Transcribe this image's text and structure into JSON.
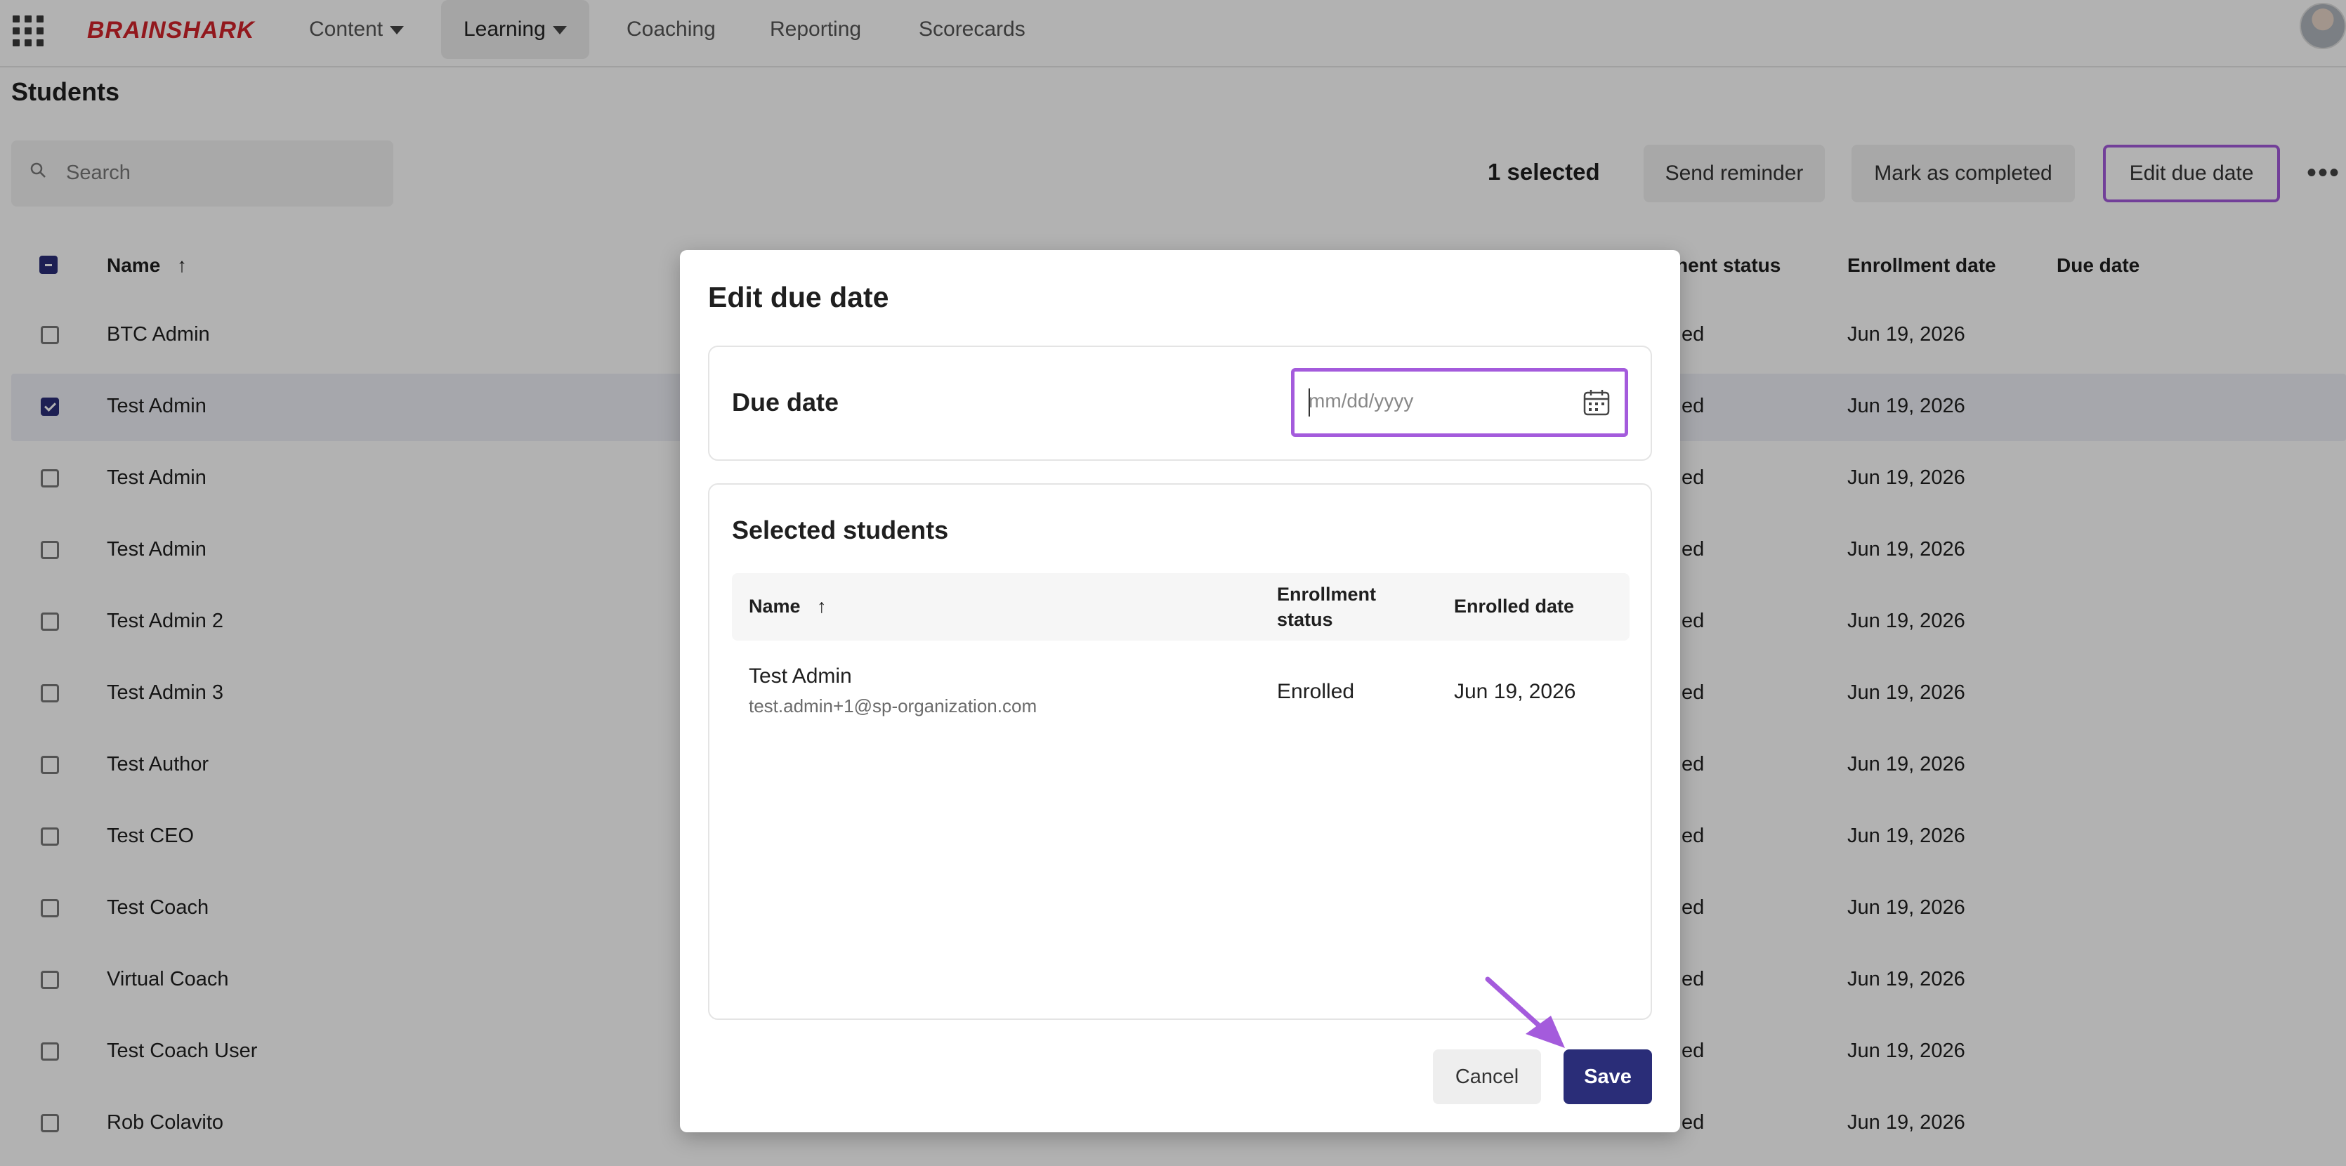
{
  "nav": {
    "logo": "BRAINSHARK",
    "items": [
      "Content",
      "Learning",
      "Coaching",
      "Reporting",
      "Scorecards"
    ]
  },
  "page": {
    "title": "Students",
    "search_placeholder": "Search",
    "selected_count": "1 selected",
    "actions": [
      "Send reminder",
      "Mark as completed",
      "Edit due date"
    ],
    "more_label": "•••"
  },
  "table": {
    "headers": {
      "name": "Name",
      "status": "nent status",
      "enroll_date": "Enrollment date",
      "due_date": "Due date"
    },
    "rows": [
      {
        "name": "BTC Admin",
        "status": "ed",
        "date": "Jun 19, 2026",
        "checked": false
      },
      {
        "name": "Test Admin",
        "status": "ed",
        "date": "Jun 19, 2026",
        "checked": true
      },
      {
        "name": "Test Admin",
        "status": "ed",
        "date": "Jun 19, 2026",
        "checked": false
      },
      {
        "name": "Test Admin",
        "status": "ed",
        "date": "Jun 19, 2026",
        "checked": false
      },
      {
        "name": "Test Admin 2",
        "status": "ed",
        "date": "Jun 19, 2026",
        "checked": false
      },
      {
        "name": "Test Admin 3",
        "status": "ed",
        "date": "Jun 19, 2026",
        "checked": false
      },
      {
        "name": "Test Author",
        "status": "ed",
        "date": "Jun 19, 2026",
        "checked": false
      },
      {
        "name": "Test CEO",
        "status": "ed",
        "date": "Jun 19, 2026",
        "checked": false
      },
      {
        "name": "Test Coach",
        "status": "ed",
        "date": "Jun 19, 2026",
        "checked": false
      },
      {
        "name": "Virtual Coach",
        "status": "ed",
        "date": "Jun 19, 2026",
        "checked": false
      },
      {
        "name": "Test Coach User",
        "status": "ed",
        "date": "Jun 19, 2026",
        "checked": false
      },
      {
        "name": "Rob Colavito",
        "status": "ed",
        "date": "Jun 19, 2026",
        "checked": false
      }
    ]
  },
  "modal": {
    "title": "Edit due date",
    "due_label": "Due date",
    "date_placeholder": "mm/dd/yyyy",
    "selected_title": "Selected students",
    "headers": {
      "name": "Name",
      "status": "Enrollment status",
      "enrolled_date": "Enrolled date"
    },
    "student": {
      "name": "Test Admin",
      "email": "test.admin+1@sp-organization.com",
      "status": "Enrolled",
      "date": "Jun 19, 2026"
    },
    "cancel_label": "Cancel",
    "save_label": "Save"
  },
  "colors": {
    "accent": "#2a2d78",
    "focus": "#a45bdc",
    "brand": "#d2232a"
  }
}
